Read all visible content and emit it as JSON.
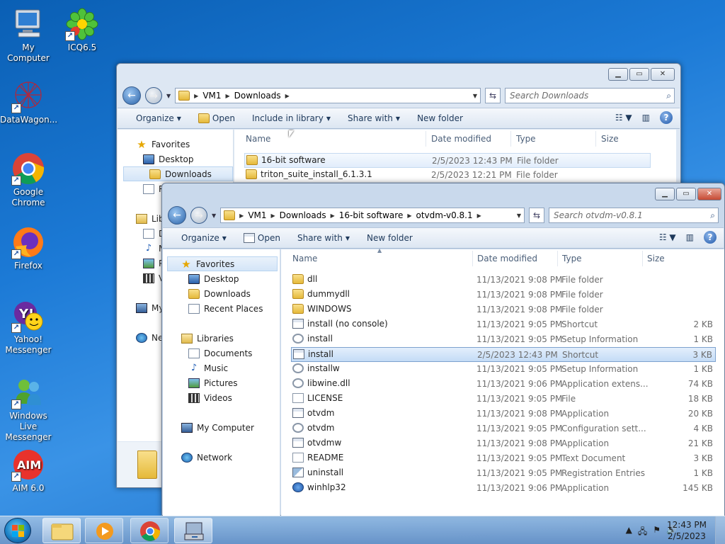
{
  "desktop": {
    "icons": [
      {
        "label": "My Computer",
        "icon": "computer-icon"
      },
      {
        "label": "ICQ6.5",
        "icon": "icq-flower-icon"
      },
      {
        "label": "DataWagon...",
        "icon": "datawagon-icon"
      },
      {
        "label": "Google Chrome",
        "icon": "chrome-icon"
      },
      {
        "label": "Firefox",
        "icon": "firefox-icon"
      },
      {
        "label": "Yahoo! Messenger",
        "icon": "yahoo-messenger-icon"
      },
      {
        "label": "Windows Live Messenger",
        "icon": "windows-live-messenger-icon"
      },
      {
        "label": "AIM 6.0",
        "icon": "aim-icon"
      }
    ]
  },
  "back_window": {
    "breadcrumb": [
      "VM1",
      "Downloads"
    ],
    "search_placeholder": "Search Downloads",
    "toolbar": [
      "Organize",
      "Open",
      "Include in library",
      "Share with",
      "New folder"
    ],
    "nav": {
      "favorites": "Favorites",
      "desktop": "Desktop",
      "downloads": "Downloads",
      "recent_fragment": "R",
      "libraries_fragment": "Lib",
      "doc_fragment": "D",
      "music_fragment": "M",
      "pictures_fragment": "P",
      "videos_fragment": "V",
      "mycomputer_fragment": "My",
      "network_fragment": "Ne"
    },
    "columns": [
      "Name",
      "Date modified",
      "Type",
      "Size"
    ],
    "rows": [
      {
        "name": "16-bit software",
        "date": "2/5/2023 12:43 PM",
        "type": "File folder"
      },
      {
        "name": "triton_suite_install_6.1.3.1",
        "date": "2/5/2023 12:21 PM",
        "type": "File folder"
      }
    ]
  },
  "front_window": {
    "breadcrumb": [
      "VM1",
      "Downloads",
      "16-bit software",
      "otvdm-v0.8.1"
    ],
    "search_placeholder": "Search otvdm-v0.8.1",
    "toolbar": [
      "Organize",
      "Open",
      "Share with",
      "New folder"
    ],
    "nav": {
      "favorites": "Favorites",
      "desktop": "Desktop",
      "downloads": "Downloads",
      "recent_places": "Recent Places",
      "libraries": "Libraries",
      "documents": "Documents",
      "music": "Music",
      "pictures": "Pictures",
      "videos": "Videos",
      "my_computer": "My Computer",
      "network": "Network"
    },
    "columns": [
      "Name",
      "Date modified",
      "Type",
      "Size"
    ],
    "rows": [
      {
        "name": "dll",
        "date": "11/13/2021 9:08 PM",
        "type": "File folder",
        "size": "",
        "icon": "folder-icon"
      },
      {
        "name": "dummydll",
        "date": "11/13/2021 9:08 PM",
        "type": "File folder",
        "size": "",
        "icon": "folder-icon"
      },
      {
        "name": "WINDOWS",
        "date": "11/13/2021 9:08 PM",
        "type": "File folder",
        "size": "",
        "icon": "folder-icon"
      },
      {
        "name": "install (no console)",
        "date": "11/13/2021 9:05 PM",
        "type": "Shortcut",
        "size": "2 KB",
        "icon": "shortcut-icon"
      },
      {
        "name": "install",
        "date": "11/13/2021 9:05 PM",
        "type": "Setup Information",
        "size": "1 KB",
        "icon": "gear-file-icon"
      },
      {
        "name": "install",
        "date": "2/5/2023 12:43 PM",
        "type": "Shortcut",
        "size": "3 KB",
        "icon": "shortcut-icon"
      },
      {
        "name": "installw",
        "date": "11/13/2021 9:05 PM",
        "type": "Setup Information",
        "size": "1 KB",
        "icon": "gear-file-icon"
      },
      {
        "name": "libwine.dll",
        "date": "11/13/2021 9:06 PM",
        "type": "Application extens...",
        "size": "74 KB",
        "icon": "dll-icon"
      },
      {
        "name": "LICENSE",
        "date": "11/13/2021 9:05 PM",
        "type": "File",
        "size": "18 KB",
        "icon": "blank-file-icon"
      },
      {
        "name": "otvdm",
        "date": "11/13/2021 9:08 PM",
        "type": "Application",
        "size": "20 KB",
        "icon": "application-icon"
      },
      {
        "name": "otvdm",
        "date": "11/13/2021 9:05 PM",
        "type": "Configuration sett...",
        "size": "4 KB",
        "icon": "gear-file-icon"
      },
      {
        "name": "otvdmw",
        "date": "11/13/2021 9:08 PM",
        "type": "Application",
        "size": "21 KB",
        "icon": "application-icon"
      },
      {
        "name": "README",
        "date": "11/13/2021 9:05 PM",
        "type": "Text Document",
        "size": "3 KB",
        "icon": "text-file-icon"
      },
      {
        "name": "uninstall",
        "date": "11/13/2021 9:05 PM",
        "type": "Registration Entries",
        "size": "1 KB",
        "icon": "registry-icon"
      },
      {
        "name": "winhlp32",
        "date": "11/13/2021 9:06 PM",
        "type": "Application",
        "size": "145 KB",
        "icon": "help-app-icon"
      }
    ],
    "selected_row_index": 5
  },
  "taskbar": {
    "time": "12:43 PM",
    "date": "2/5/2023",
    "buttons": [
      "start-orb-icon",
      "file-explorer-icon",
      "media-player-icon",
      "chrome-icon",
      "setup-program-icon"
    ]
  },
  "colors": {
    "desktop_blue": "#1c7ad6",
    "selection": "#c4dcf6",
    "link_text": "#1e395b"
  }
}
